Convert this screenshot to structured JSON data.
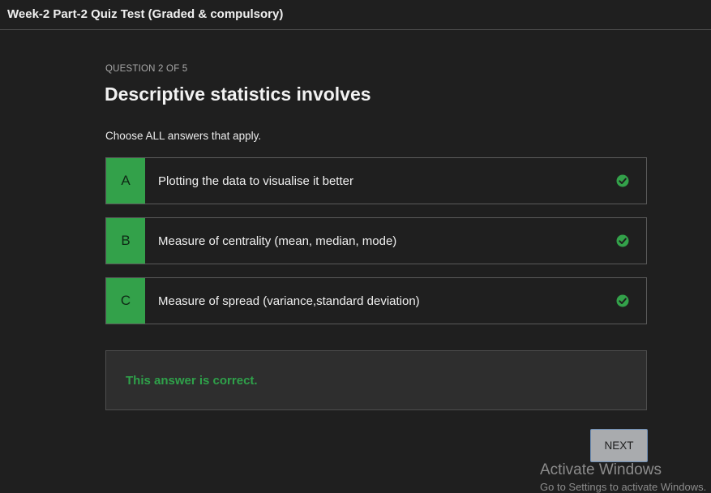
{
  "header": {
    "title": "Week-2 Part-2 Quiz Test (Graded & compulsory)"
  },
  "question": {
    "counter": "QUESTION 2 OF 5",
    "title": "Descriptive statistics involves",
    "instruction": "Choose ALL answers that apply."
  },
  "options": [
    {
      "letter": "A",
      "label": "Plotting the data to visualise it better",
      "selected": true,
      "correct": true
    },
    {
      "letter": "B",
      "label": "Measure of centrality (mean, median, mode)",
      "selected": true,
      "correct": true
    },
    {
      "letter": "C",
      "label": "Measure of spread (variance,standard deviation)",
      "selected": true,
      "correct": true
    }
  ],
  "feedback": {
    "text": "This answer is correct."
  },
  "next_button": {
    "label": "NEXT"
  },
  "watermark": {
    "title": "Activate Windows",
    "subtitle": "Go to Settings to activate Windows."
  },
  "colors": {
    "accent_green": "#33a14a",
    "feedback_green": "#2fa14a",
    "background": "#1f1f1f"
  },
  "icons": {
    "check": "check-circle-icon"
  }
}
